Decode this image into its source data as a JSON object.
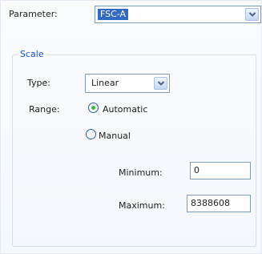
{
  "parameter": {
    "label": "Parameter:",
    "selected": "FSC-A",
    "dropdown_icon": "chevron-down-icon"
  },
  "scale": {
    "legend": "Scale",
    "type_label": "Type:",
    "type_selected": "Linear",
    "range_label": "Range:",
    "options": {
      "automatic": {
        "label": "Automatic",
        "checked": true
      },
      "manual": {
        "label": "Manual",
        "checked": false
      }
    },
    "minimum_label": "Minimum:",
    "minimum_value": "0",
    "maximum_label": "Maximum:",
    "maximum_value": "8388608"
  },
  "colors": {
    "selection": "#3169c6",
    "legend": "#1a55c5",
    "radio_dot": "#3fb83f"
  }
}
